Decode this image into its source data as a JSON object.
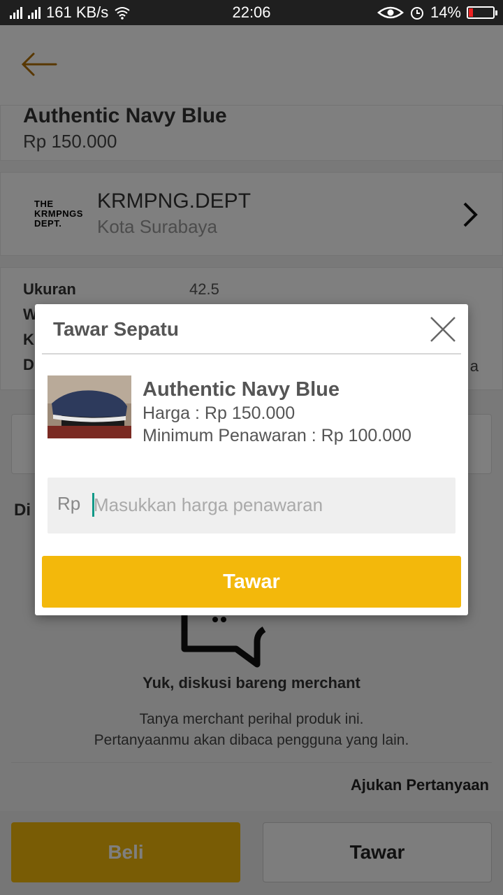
{
  "status_bar": {
    "network_speed": "161 KB/s",
    "time": "22:06",
    "battery": "14%"
  },
  "product": {
    "name": "Authentic Navy Blue",
    "price": "Rp 150.000"
  },
  "shop": {
    "logo_text": [
      "THE",
      "KRMPNGS",
      "DEPT."
    ],
    "name": "KRMPNG.DEPT",
    "city": "Kota Surabaya"
  },
  "specs": [
    {
      "label": "Ukuran",
      "value": "42.5"
    },
    {
      "label": "W",
      "value": ""
    },
    {
      "label": "K",
      "value": ""
    },
    {
      "label": "D",
      "value": ""
    }
  ],
  "spec_trailing": "a",
  "discussion": {
    "label": "Di",
    "title": "Yuk, diskusi bareng merchant",
    "subtitle_line1": "Tanya merchant perihal produk ini.",
    "subtitle_line2": "Pertanyaanmu akan dibaca pengguna yang lain.",
    "ask_link": "Ajukan Pertanyaan"
  },
  "bottom": {
    "buy_label": "Beli",
    "bid_label": "Tawar"
  },
  "dialog": {
    "title": "Tawar Sepatu",
    "product_name": "Authentic Navy Blue",
    "price_text": "Harga : Rp 150.000",
    "min_offer_text": "Minimum Penawaran : Rp 100.000",
    "currency_prefix": "Rp",
    "input_value": "",
    "input_placeholder": "Masukkan harga penawaran",
    "submit_label": "Tawar"
  },
  "colors": {
    "accent_yellow": "#f3b80b",
    "back_arrow": "#b06e00",
    "cursor_teal": "#119988"
  }
}
